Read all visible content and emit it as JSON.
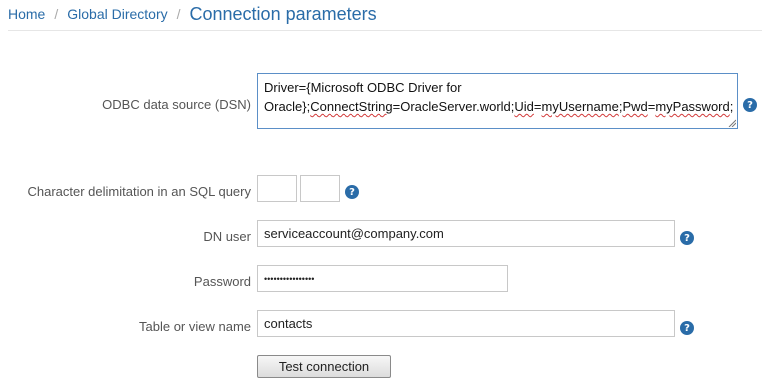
{
  "breadcrumb": {
    "home": "Home",
    "global_directory": "Global Directory",
    "current": "Connection parameters"
  },
  "form": {
    "dsn": {
      "label": "ODBC data source (DSN)",
      "value_line1": "Driver={Microsoft ODBC Driver for",
      "value_line2_a": "Oracle};",
      "value_line2_b": "ConnectString",
      "value_line2_c": "=",
      "value_line2_d": "OracleServer.world",
      "value_line2_e": ";",
      "value_line2_f": "Uid",
      "value_line2_g": "=",
      "value_line2_h": "myUsername",
      "value_line2_i": ";",
      "value_line2_j": "Pwd",
      "value_line2_k": "=",
      "value_line2_l": "myPassword",
      "value_line2_m": ";"
    },
    "char_delim": {
      "label": "Character delimitation in an SQL query",
      "value_left": "",
      "value_right": ""
    },
    "dn_user": {
      "label": "DN user",
      "value": "serviceaccount@company.com"
    },
    "password": {
      "label": "Password",
      "value": "••••••••••••••••"
    },
    "table": {
      "label": "Table or view name",
      "value": "contacts"
    },
    "test_button": "Test connection",
    "help_glyph": "?"
  }
}
